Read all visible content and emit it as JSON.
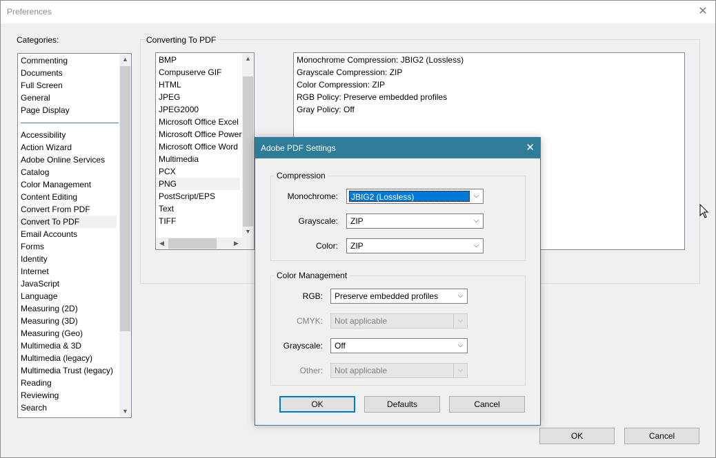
{
  "window": {
    "title": "Preferences",
    "close_glyph": "✕"
  },
  "categories": {
    "label": "Categories:",
    "top_items": [
      "Commenting",
      "Documents",
      "Full Screen",
      "General",
      "Page Display"
    ],
    "items": [
      "Accessibility",
      "Action Wizard",
      "Adobe Online Services",
      "Catalog",
      "Color Management",
      "Content Editing",
      "Convert From PDF",
      "Convert To PDF",
      "Email Accounts",
      "Forms",
      "Identity",
      "Internet",
      "JavaScript",
      "Language",
      "Measuring (2D)",
      "Measuring (3D)",
      "Measuring (Geo)",
      "Multimedia & 3D",
      "Multimedia (legacy)",
      "Multimedia Trust (legacy)",
      "Reading",
      "Reviewing",
      "Search"
    ],
    "selected": "Convert To PDF"
  },
  "converting": {
    "group_label": "Converting To PDF",
    "formats": [
      "BMP",
      "Compuserve GIF",
      "HTML",
      "JPEG",
      "JPEG2000",
      "Microsoft Office Excel",
      "Microsoft Office Powerl",
      "Microsoft Office Word",
      "Multimedia",
      "PCX",
      "PNG",
      "PostScript/EPS",
      "Text",
      "TIFF"
    ],
    "selected_format": "PNG",
    "summary": [
      "Monochrome Compression: JBIG2 (Lossless)",
      "Grayscale Compression: ZIP",
      "Color Compression: ZIP",
      "RGB Policy: Preserve embedded profiles",
      "Gray Policy: Off"
    ]
  },
  "dialog": {
    "title": "Adobe PDF Settings",
    "close_glyph": "✕",
    "compression": {
      "group_label": "Compression",
      "monochrome_label": "Monochrome:",
      "monochrome_value": "JBIG2 (Lossless)",
      "grayscale_label": "Grayscale:",
      "grayscale_value": "ZIP",
      "color_label": "Color:",
      "color_value": "ZIP"
    },
    "color_management": {
      "group_label": "Color Management",
      "rgb_label": "RGB:",
      "rgb_value": "Preserve embedded profiles",
      "cmyk_label": "CMYK:",
      "cmyk_value": "Not applicable",
      "grayscale_label": "Grayscale:",
      "grayscale_value": "Off",
      "other_label": "Other:",
      "other_value": "Not applicable"
    },
    "buttons": {
      "ok": "OK",
      "defaults": "Defaults",
      "cancel": "Cancel"
    }
  },
  "main_buttons": {
    "ok": "OK",
    "cancel": "Cancel"
  },
  "colors": {
    "dialog_titlebar": "#2f7c98",
    "selection": "#0078d7",
    "accent_divider": "#3a7fd0"
  }
}
